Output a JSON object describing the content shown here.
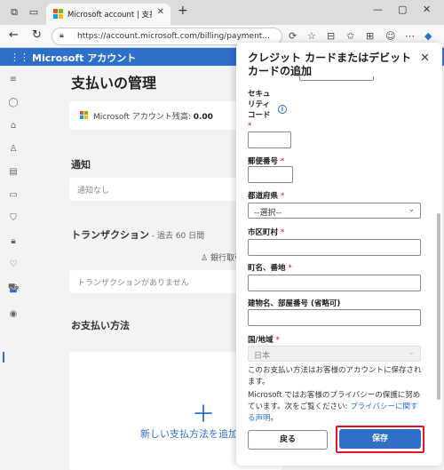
{
  "browser": {
    "tab_title": "Microsoft account | 支払いオプショ",
    "tab_close": "✕",
    "new_tab": "+",
    "url": "https://account.microsoft.com/billing/payment..."
  },
  "header": {
    "brand": "Microsoft アカウント"
  },
  "main": {
    "page_title": "支払いの管理",
    "balance_label": "Microsoft アカウント残高: ",
    "balance_value": "0.00",
    "notifications_heading": "通知",
    "notifications_empty": "通知なし",
    "transactions_heading": "トランザクション",
    "transactions_period": " - 過去 60 日間",
    "bank_link": "銀行取引",
    "transactions_empty": "トランザクションがありません",
    "payment_heading": "お支払い方法",
    "add_payment": "新しい支払方法を追加"
  },
  "dialog": {
    "title": "クレジット カードまたはデビット カードの追加",
    "close": "✕",
    "fields": {
      "security_code": {
        "label_1": "セキュ",
        "label_2": "リティ",
        "label_3": "コード",
        "required": "*",
        "info": "i"
      },
      "postal_code": {
        "label": "郵便番号",
        "required": "*"
      },
      "prefecture": {
        "label": "都道府県",
        "required": "*",
        "value": "--選択--"
      },
      "city": {
        "label": "市区町村",
        "required": "*"
      },
      "street": {
        "label": "町名、番地",
        "required": "*"
      },
      "building": {
        "label": "建物名、部屋番号 (省略可)"
      },
      "country": {
        "label": "国/地域",
        "required": "*",
        "value": "日本"
      }
    },
    "note_account": "このお支払い方法はお客様のアカウントに保存されます。",
    "privacy_text": "Microsoft ではお客様のプライバシーの保護に努めています。次をご覧ください: ",
    "privacy_link": "プライバシーに関する声明",
    "privacy_end": "。",
    "back_label": "戻る",
    "save_label": "保存"
  },
  "colors": {
    "accent": "#2e6fca",
    "highlight": "#e8102a"
  }
}
